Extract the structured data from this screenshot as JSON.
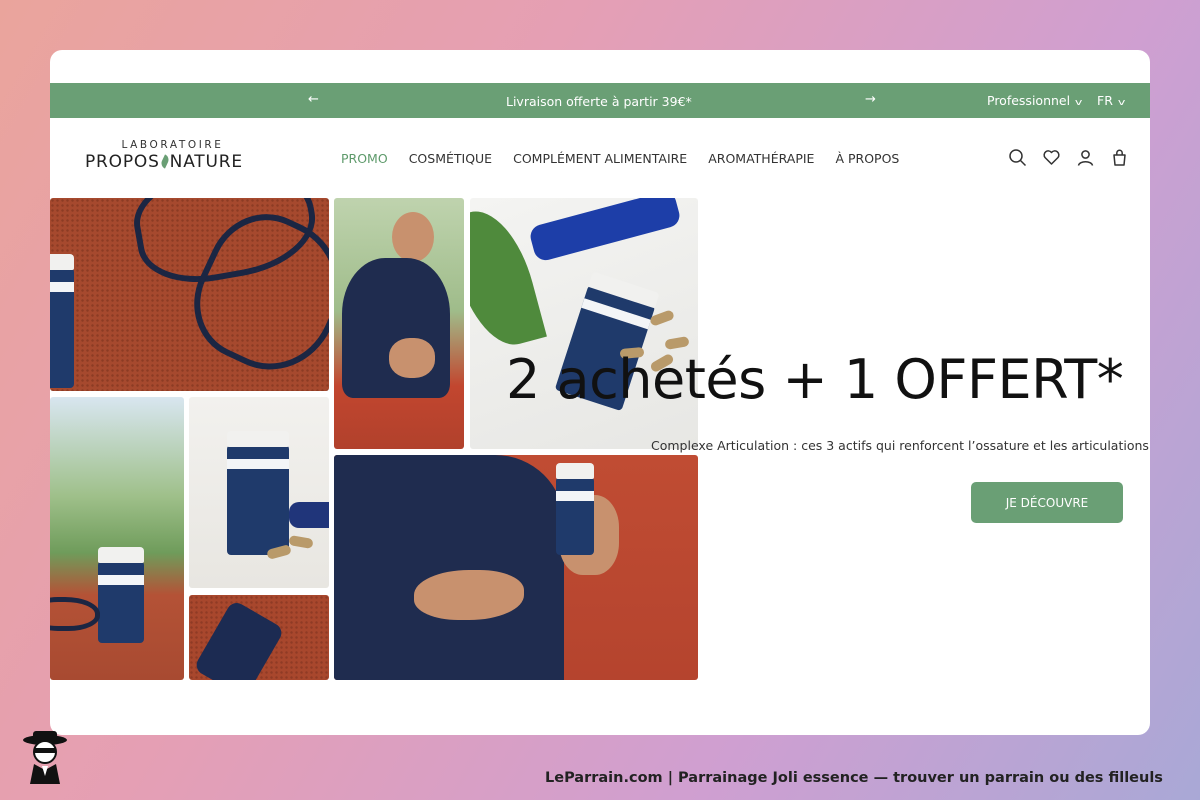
{
  "promo_bar": {
    "prev_arrow": "←",
    "message": "Livraison offerte à partir 39€*",
    "next_arrow": "→",
    "pro_label": "Professionnel",
    "lang_label": "FR"
  },
  "header": {
    "logo_top": "LABORATOIRE",
    "logo_left": "PROPOS",
    "logo_right": "NATURE",
    "nav": [
      "PROMO",
      "COSMÉTIQUE",
      "COMPLÉMENT ALIMENTAIRE",
      "AROMATHÉRAPIE",
      "À PROPOS"
    ],
    "icons": [
      "search-icon",
      "heart-icon",
      "user-icon",
      "bag-icon"
    ]
  },
  "hero": {
    "headline": "2 achetés + 1 OFFERT*",
    "subtitle": "Complexe Articulation : ces 3 actifs qui renforcent l’ossature et les articulations",
    "cta_label": "JE DÉCOUVRE"
  },
  "footer": {
    "caption": "LeParrain.com | Parrainage Joli essence — trouver un parrain ou des filleuls"
  },
  "colors": {
    "accent": "#6a9f75",
    "text": "#111111"
  }
}
